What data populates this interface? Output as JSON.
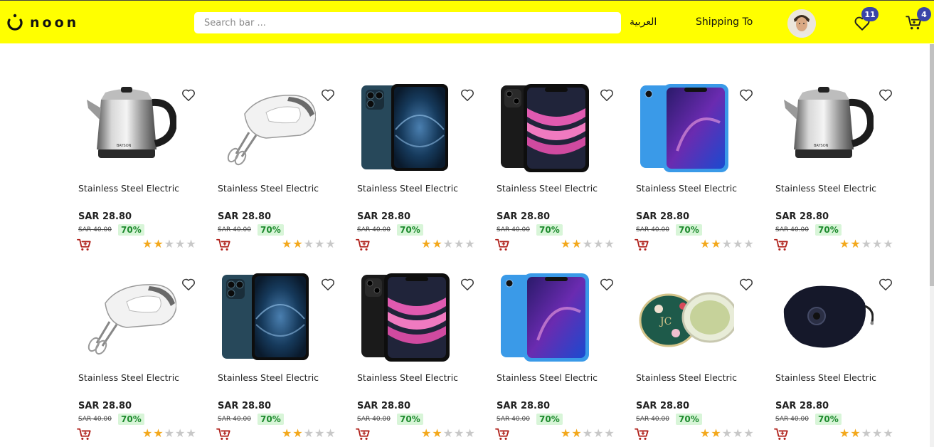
{
  "header": {
    "logo_text": "noon",
    "search_placeholder": "Search bar ...",
    "language": "العربية",
    "shipping": "Shipping To",
    "wishlist_count": "11",
    "cart_count": "4",
    "colors": {
      "bar": "#ffff00",
      "badge": "#3a45a8"
    }
  },
  "products": [
    {
      "image": "kettle",
      "name": "Stainless Steel Electric",
      "price": "SAR 28.80",
      "old_price": "SAR 40.00",
      "discount": "70%",
      "rating": 2
    },
    {
      "image": "mixer",
      "name": "Stainless Steel Electric",
      "price": "SAR 28.80",
      "old_price": "SAR 40.00",
      "discount": "70%",
      "rating": 2
    },
    {
      "image": "iphone-pro",
      "name": "Stainless Steel Electric",
      "price": "SAR 28.80",
      "old_price": "SAR 40.00",
      "discount": "70%",
      "rating": 2
    },
    {
      "image": "iphone-11",
      "name": "Stainless Steel Electric",
      "price": "SAR 28.80",
      "old_price": "SAR 40.00",
      "discount": "70%",
      "rating": 2
    },
    {
      "image": "iphone-xr",
      "name": "Stainless Steel Electric",
      "price": "SAR 28.80",
      "old_price": "SAR 40.00",
      "discount": "70%",
      "rating": 2
    },
    {
      "image": "kettle",
      "name": "Stainless Steel Electric",
      "price": "SAR 28.80",
      "old_price": "SAR 40.00",
      "discount": "70%",
      "rating": 2
    },
    {
      "image": "mixer",
      "name": "Stainless Steel Electric",
      "price": "SAR 28.80",
      "old_price": "SAR 40.00",
      "discount": "70%",
      "rating": 2
    },
    {
      "image": "iphone-pro",
      "name": "Stainless Steel Electric",
      "price": "SAR 28.80",
      "old_price": "SAR 40.00",
      "discount": "70%",
      "rating": 2
    },
    {
      "image": "iphone-11",
      "name": "Stainless Steel Electric",
      "price": "SAR 28.80",
      "old_price": "SAR 40.00",
      "discount": "70%",
      "rating": 2
    },
    {
      "image": "iphone-xr",
      "name": "Stainless Steel Electric",
      "price": "SAR 28.80",
      "old_price": "SAR 40.00",
      "discount": "70%",
      "rating": 2
    },
    {
      "image": "mirror",
      "name": "Stainless Steel Electric",
      "price": "SAR 28.80",
      "old_price": "SAR 40.00",
      "discount": "70%",
      "rating": 2
    },
    {
      "image": "mask",
      "name": "Stainless Steel Electric",
      "price": "SAR 28.80",
      "old_price": "SAR 40.00",
      "discount": "70%",
      "rating": 2
    }
  ],
  "rating_max": 5
}
